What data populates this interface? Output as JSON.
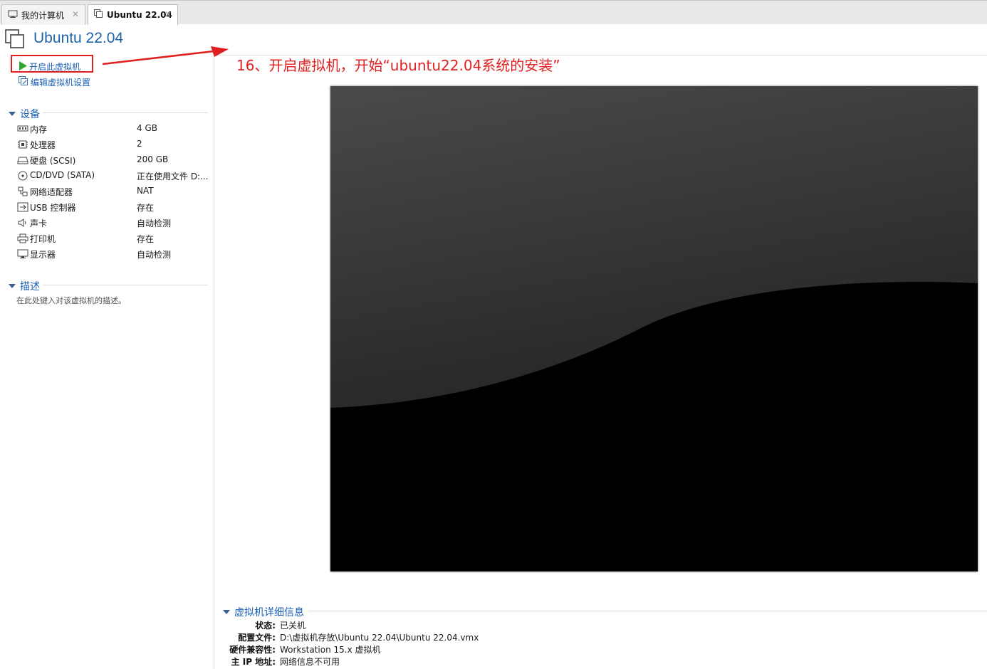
{
  "tabs": [
    {
      "label": "我的计算机",
      "icon": "computer-icon",
      "active": false
    },
    {
      "label": "Ubuntu 22.04",
      "icon": "vm-icon",
      "active": true
    }
  ],
  "vm": {
    "title": "Ubuntu 22.04"
  },
  "actions": {
    "power_on": "开启此虚拟机",
    "edit_settings": "编辑虚拟机设置"
  },
  "devices": {
    "heading": "设备",
    "items": [
      {
        "name": "内存",
        "value": "4 GB",
        "icon": "memory-icon"
      },
      {
        "name": "处理器",
        "value": "2",
        "icon": "cpu-icon"
      },
      {
        "name": "硬盘 (SCSI)",
        "value": "200 GB",
        "icon": "harddisk-icon"
      },
      {
        "name": "CD/DVD (SATA)",
        "value": "正在使用文件 D:...",
        "icon": "cdrom-icon"
      },
      {
        "name": "网络适配器",
        "value": "NAT",
        "icon": "network-icon"
      },
      {
        "name": "USB 控制器",
        "value": "存在",
        "icon": "usb-icon"
      },
      {
        "name": "声卡",
        "value": "自动检测",
        "icon": "sound-icon"
      },
      {
        "name": "打印机",
        "value": "存在",
        "icon": "printer-icon"
      },
      {
        "name": "显示器",
        "value": "自动检测",
        "icon": "display-icon"
      }
    ]
  },
  "description": {
    "heading": "描述",
    "placeholder": "在此处键入对该虚拟机的描述。"
  },
  "annotation": {
    "text": "16、开启虚拟机，开始“ubuntu22.04系统的安装”",
    "color": "#e02020"
  },
  "details": {
    "heading": "虚拟机详细信息",
    "rows": [
      {
        "label": "状态:",
        "value": "已关机"
      },
      {
        "label": "配置文件:",
        "value": "D:\\虚拟机存放\\Ubuntu 22.04\\Ubuntu 22.04.vmx"
      },
      {
        "label": "硬件兼容性:",
        "value": "Workstation 15.x 虚拟机"
      },
      {
        "label": "主 IP 地址:",
        "value": "网络信息不可用"
      }
    ]
  },
  "colors": {
    "accent": "#1a5fb4",
    "title": "#1f63a8",
    "play": "#2fa82f",
    "highlight": "#e02020"
  }
}
